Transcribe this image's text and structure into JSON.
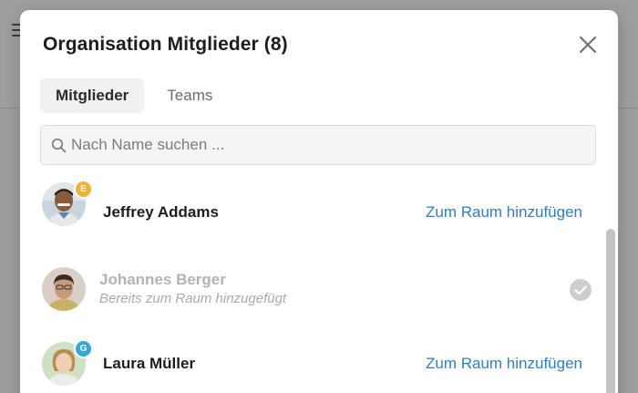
{
  "modal": {
    "title": "Organisation Mitglieder (8)"
  },
  "tabs": [
    {
      "label": "Mitglieder",
      "active": true
    },
    {
      "label": "Teams",
      "active": false
    }
  ],
  "search": {
    "placeholder": "Nach Name suchen ...",
    "value": ""
  },
  "members": [
    {
      "name": "Jeffrey Addams",
      "badge": "E",
      "badge_color": "#eab33a",
      "action_label": "Zum Raum hinzufügen",
      "added": false
    },
    {
      "name": "Johannes Berger",
      "status": "Bereits zum Raum hinzugefügt",
      "added": true
    },
    {
      "name": "Laura Müller",
      "badge": "G",
      "badge_color": "#35a8d4",
      "action_label": "Zum Raum hinzufügen",
      "added": false
    }
  ],
  "colors": {
    "link": "#2f7ec0",
    "muted_text": "#b3b3b3",
    "modal_bg": "#ffffff",
    "overlay": "#9d9d9d"
  },
  "icons": {
    "close": "close-icon",
    "search": "search-icon",
    "check": "check-circle-icon",
    "menu": "hamburger-menu-icon"
  }
}
